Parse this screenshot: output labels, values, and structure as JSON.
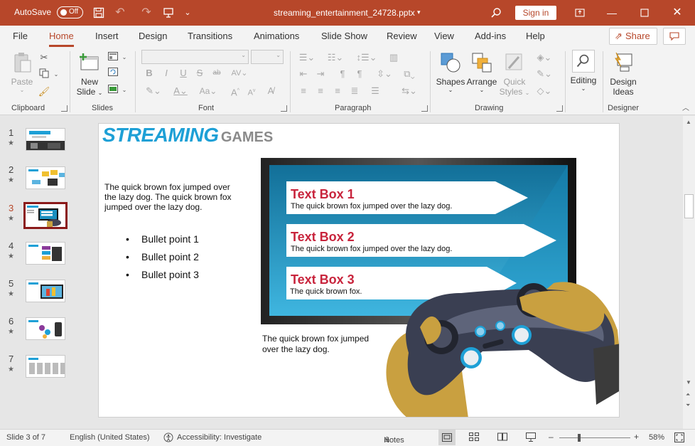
{
  "titlebar": {
    "autosave_label": "AutoSave",
    "autosave_state": "Off",
    "doc_title": "streaming_entertainment_24728.pptx",
    "signin_label": "Sign in"
  },
  "menu": {
    "tabs": [
      "File",
      "Home",
      "Insert",
      "Design",
      "Transitions",
      "Animations",
      "Slide Show",
      "Review",
      "View",
      "Add-ins",
      "Help"
    ],
    "active": "Home",
    "share_label": "Share"
  },
  "ribbon": {
    "clipboard": {
      "label": "Clipboard",
      "paste": "Paste"
    },
    "slides": {
      "label": "Slides",
      "new_slide_line1": "New",
      "new_slide_line2": "Slide"
    },
    "font": {
      "label": "Font"
    },
    "paragraph": {
      "label": "Paragraph"
    },
    "drawing": {
      "label": "Drawing",
      "shapes": "Shapes",
      "arrange": "Arrange",
      "quick_styles_line1": "Quick",
      "quick_styles_line2": "Styles"
    },
    "editing": {
      "label": "Editing"
    },
    "designer": {
      "label": "Designer",
      "design_ideas_line1": "Design",
      "design_ideas_line2": "Ideas"
    }
  },
  "thumbnails": {
    "numbers": [
      "1",
      "2",
      "3",
      "4",
      "5",
      "6",
      "7"
    ],
    "active_index": 3,
    "star": "★"
  },
  "slide": {
    "title_main": "STREAMING",
    "title_sub": "GAMES",
    "left_paragraph": "The quick brown fox jumped over the lazy dog. The quick brown fox jumped over the lazy dog.",
    "bullets": [
      "Bullet point 1",
      "Bullet point 2",
      "Bullet point 3"
    ],
    "caption": "The quick brown fox jumped over the lazy dog.",
    "text_boxes": [
      {
        "title": "Text Box 1",
        "body": "The quick brown fox jumped over the lazy dog."
      },
      {
        "title": "Text Box 2",
        "body": "The quick brown fox jumped over the lazy dog."
      },
      {
        "title": "Text Box 3",
        "body": "The quick brown fox."
      }
    ],
    "colors": {
      "title_blue": "#1ea0d6",
      "title_grey": "#8a8a8a",
      "box_red": "#c8243c",
      "screen_blue": "#1a8fbf"
    }
  },
  "status": {
    "slide_info": "Slide 3 of 7",
    "language": "English (United States)",
    "accessibility": "Accessibility: Investigate",
    "notes": "Notes",
    "zoom_minus": "–",
    "zoom_plus": "+",
    "zoom": "58%"
  }
}
